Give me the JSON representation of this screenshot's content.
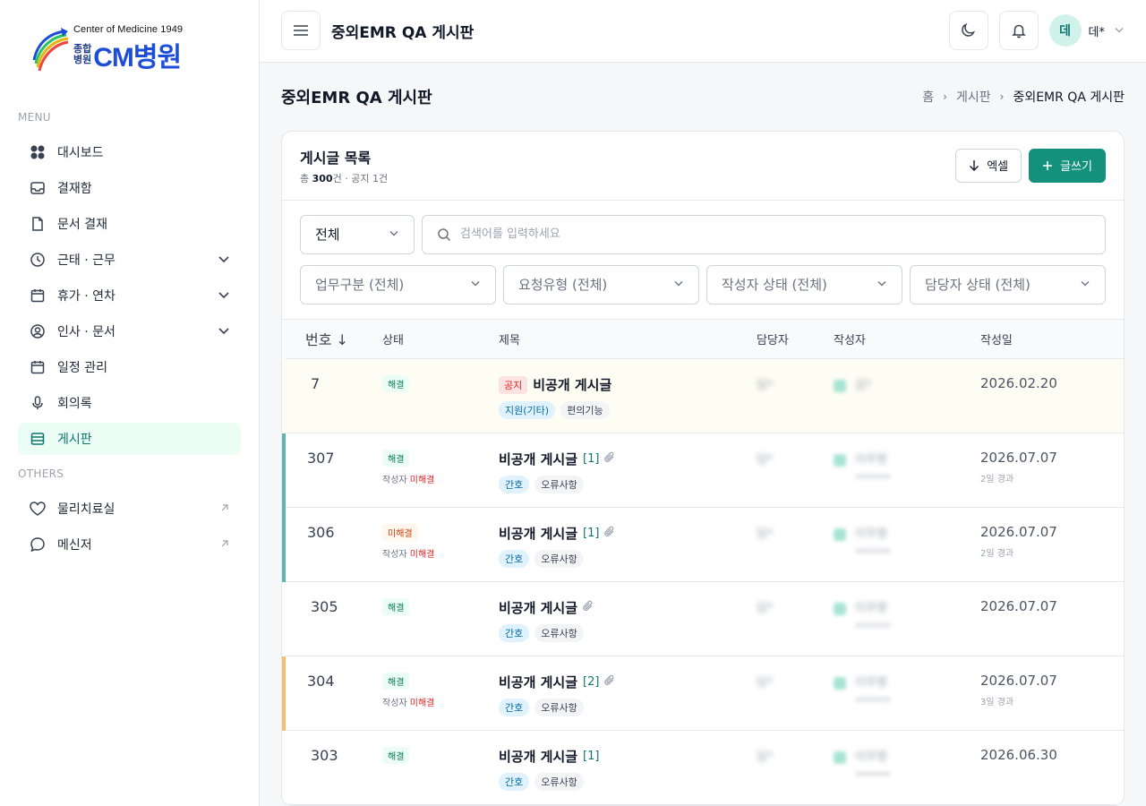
{
  "logo": {
    "english": "Center of Medicine 1949",
    "small_top": "종합",
    "small_bottom": "병원",
    "main": "CM병원"
  },
  "sidebar": {
    "menu_label": "MENU",
    "others_label": "OTHERS",
    "items": [
      {
        "label": "대시보드",
        "icon": "grid-icon"
      },
      {
        "label": "결재함",
        "icon": "inbox-icon"
      },
      {
        "label": "문서 결재",
        "icon": "document-icon"
      },
      {
        "label": "근태 · 근무",
        "icon": "clock-icon",
        "expandable": true
      },
      {
        "label": "휴가 · 연차",
        "icon": "calendar-icon",
        "expandable": true
      },
      {
        "label": "인사 · 문서",
        "icon": "user-circle-icon",
        "expandable": true
      },
      {
        "label": "일정 관리",
        "icon": "calendar-icon"
      },
      {
        "label": "회의록",
        "icon": "microphone-icon"
      },
      {
        "label": "게시판",
        "icon": "board-icon",
        "active": true
      }
    ],
    "others": [
      {
        "label": "물리치료실",
        "icon": "heart-icon"
      },
      {
        "label": "메신저",
        "icon": "chat-icon"
      }
    ]
  },
  "topbar": {
    "title": "중외EMR QA 게시판",
    "avatar_initial": "데",
    "user_name": "데*"
  },
  "page": {
    "title": "중외EMR QA 게시판",
    "breadcrumb": [
      "홈",
      "게시판",
      "중외EMR QA 게시판"
    ]
  },
  "card": {
    "title": "게시글 목록",
    "summary_prefix": "총 ",
    "summary_count": "300",
    "summary_suffix": "건 · 공지 1건",
    "excel_label": "엑셀",
    "write_label": "글쓰기"
  },
  "filters": {
    "scope": "전체",
    "search_placeholder": "검색어를 입력하세요",
    "work_type": "업무구분 (전체)",
    "request_type": "요청유형 (전체)",
    "writer_status": "작성자 상태 (전체)",
    "assignee_status": "담당자 상태 (전체)"
  },
  "table": {
    "headers": {
      "no": "번호 ↓",
      "status": "상태",
      "title": "제목",
      "assignee": "담당자",
      "writer": "작성자",
      "date": "작성일"
    },
    "rows": [
      {
        "no": "7",
        "status": "해결",
        "status_type": "ok",
        "notice": "공지",
        "title": "비공개 게시글",
        "tags": [
          "지원(기타)",
          "편의기능"
        ],
        "date": "2026.02.20",
        "assignee": "담*",
        "writer": "김*"
      },
      {
        "no": "307",
        "status": "해결",
        "status_type": "ok",
        "writer_sub_prefix": "작성자 ",
        "writer_sub_value": "미해결",
        "title": "비공개 게시글",
        "comments": "[1]",
        "clip": true,
        "tags": [
          "간호",
          "오류사항"
        ],
        "date": "2026.07.07",
        "date_sub": "2일 경과",
        "bar": "#5bb8b0",
        "assignee": "담*",
        "writer": "이무명"
      },
      {
        "no": "306",
        "status": "미해결",
        "status_type": "no",
        "writer_sub_prefix": "작성자 ",
        "writer_sub_value": "미해결",
        "title": "비공개 게시글",
        "comments": "[1]",
        "clip": true,
        "tags": [
          "간호",
          "오류사항"
        ],
        "date": "2026.07.07",
        "date_sub": "2일 경과",
        "bar": "#5bb8b0",
        "assignee": "담*",
        "writer": "이무명"
      },
      {
        "no": "305",
        "status": "해결",
        "status_type": "ok",
        "title": "비공개 게시글",
        "clip": true,
        "tags": [
          "간호",
          "오류사항"
        ],
        "date": "2026.07.07",
        "assignee": "담*",
        "writer": "이무명"
      },
      {
        "no": "304",
        "status": "해결",
        "status_type": "ok",
        "writer_sub_prefix": "작성자 ",
        "writer_sub_value": "미해결",
        "title": "비공개 게시글",
        "comments": "[2]",
        "clip": true,
        "tags": [
          "간호",
          "오류사항"
        ],
        "date": "2026.07.07",
        "date_sub": "3일 경과",
        "bar": "#f5c06b",
        "assignee": "담*",
        "writer": "이무명"
      },
      {
        "no": "303",
        "status": "해결",
        "status_type": "ok",
        "title": "비공개 게시글",
        "comments": "[1]",
        "tags": [
          "간호",
          "오류사항"
        ],
        "date": "2026.06.30",
        "assignee": "담*",
        "writer": "이무명"
      }
    ]
  },
  "colors": {
    "accent": "#14917d",
    "active_bg": "#ecfdf5"
  }
}
